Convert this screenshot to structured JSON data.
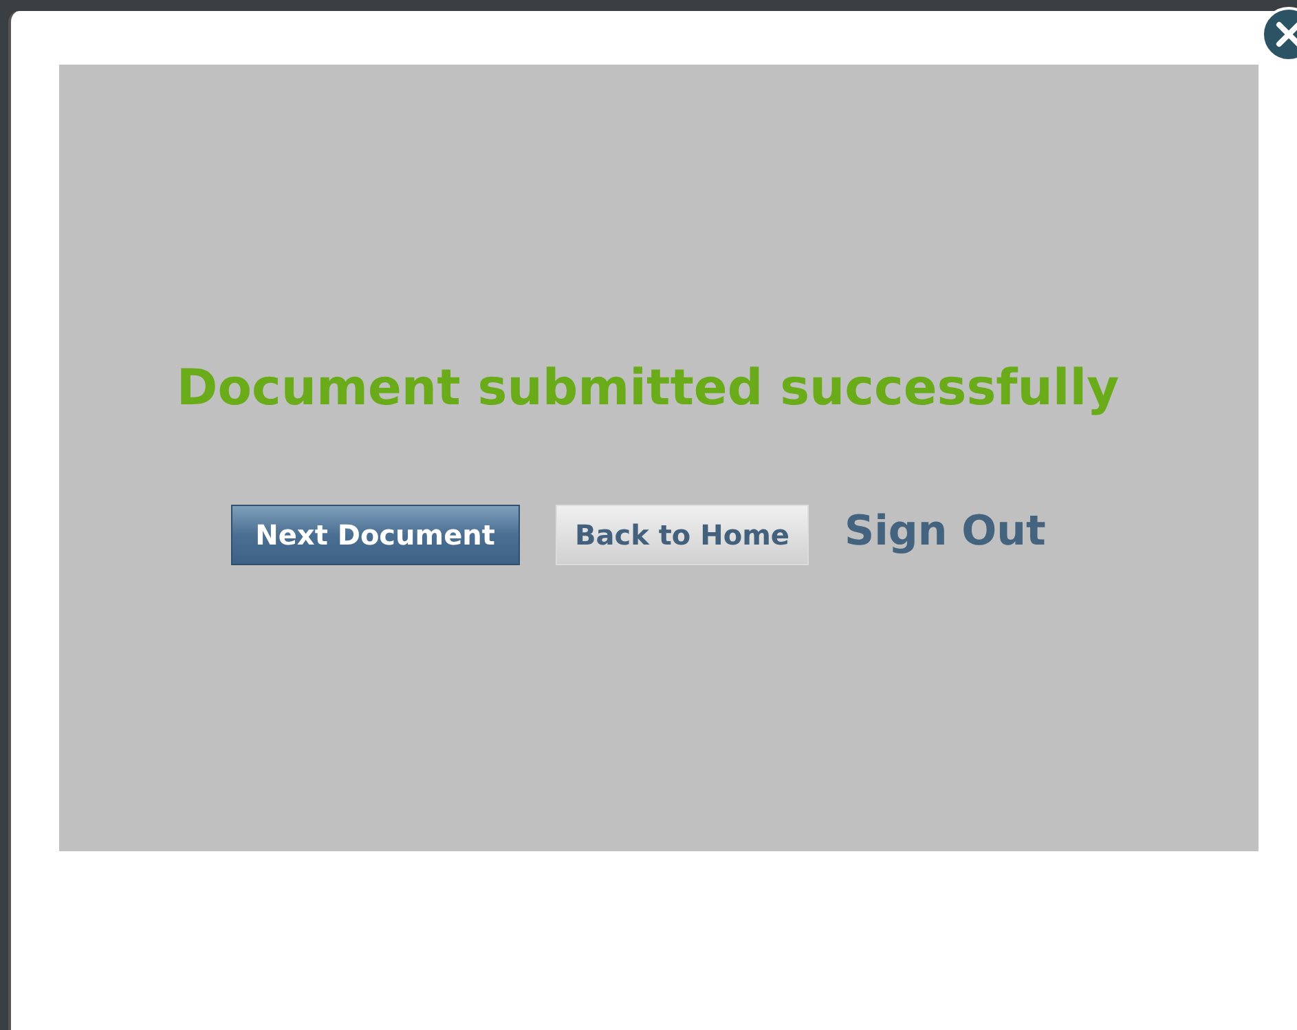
{
  "message": "Document submitted successfully",
  "actions": [
    {
      "label": "Next Document",
      "kind": "primary"
    },
    {
      "label": "Back to Home",
      "kind": "secondary"
    },
    {
      "label": "Sign Out",
      "kind": "link"
    }
  ]
}
